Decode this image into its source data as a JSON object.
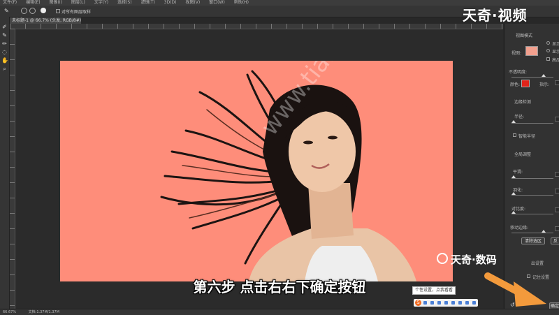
{
  "menubar": {
    "items": [
      "文件(F)",
      "编辑(E)",
      "图像(I)",
      "图层(L)",
      "文字(Y)",
      "选择(S)",
      "滤镜(T)",
      "3D(D)",
      "视图(V)",
      "窗口(W)",
      "帮助(H)"
    ]
  },
  "options_bar": {
    "checkbox_label": "对所有图层取样"
  },
  "document_tab": {
    "title": "未标题-1 @ 66.7% (头发, RGB/8#) *"
  },
  "canvas": {
    "background_color": "#fe8d7a",
    "watermark": "www.tianqijun.com"
  },
  "properties_panel": {
    "view_mode_label": "视图模式",
    "view_label": "视图:",
    "show_edge": "显示",
    "show_original": "显示",
    "high_quality": "高品",
    "opacity_label": "不透明度:",
    "color_label": "颜色:",
    "indicate_label": "指示:",
    "edge_detection_title": "边缘检测",
    "radius_label": "半径:",
    "smart_radius": "智能半径",
    "global_refine_title": "全局调整",
    "smooth_label": "平滑:",
    "feather_label": "羽化:",
    "contrast_label": "对比度:",
    "shift_edge_label": "移动边缘:",
    "clear_selection_btn": "清除选区",
    "invert_btn": "反",
    "output_settings": "出设置",
    "remember_settings": "记住设置",
    "ok_btn": "确定",
    "color_swatch": "#e0231a"
  },
  "status_bar": {
    "zoom": "66.67%",
    "doc_info": "文档:1.37M/1.37M"
  },
  "brand": {
    "top": "天奇·视频",
    "bottom": "天奇·数码"
  },
  "subtitle": "第六步 点击右右下确定按钮",
  "ime": {
    "tooltip": "个性设置，点我看看",
    "logo": "S"
  },
  "colors": {
    "accent_orange": "#f39a3c"
  }
}
